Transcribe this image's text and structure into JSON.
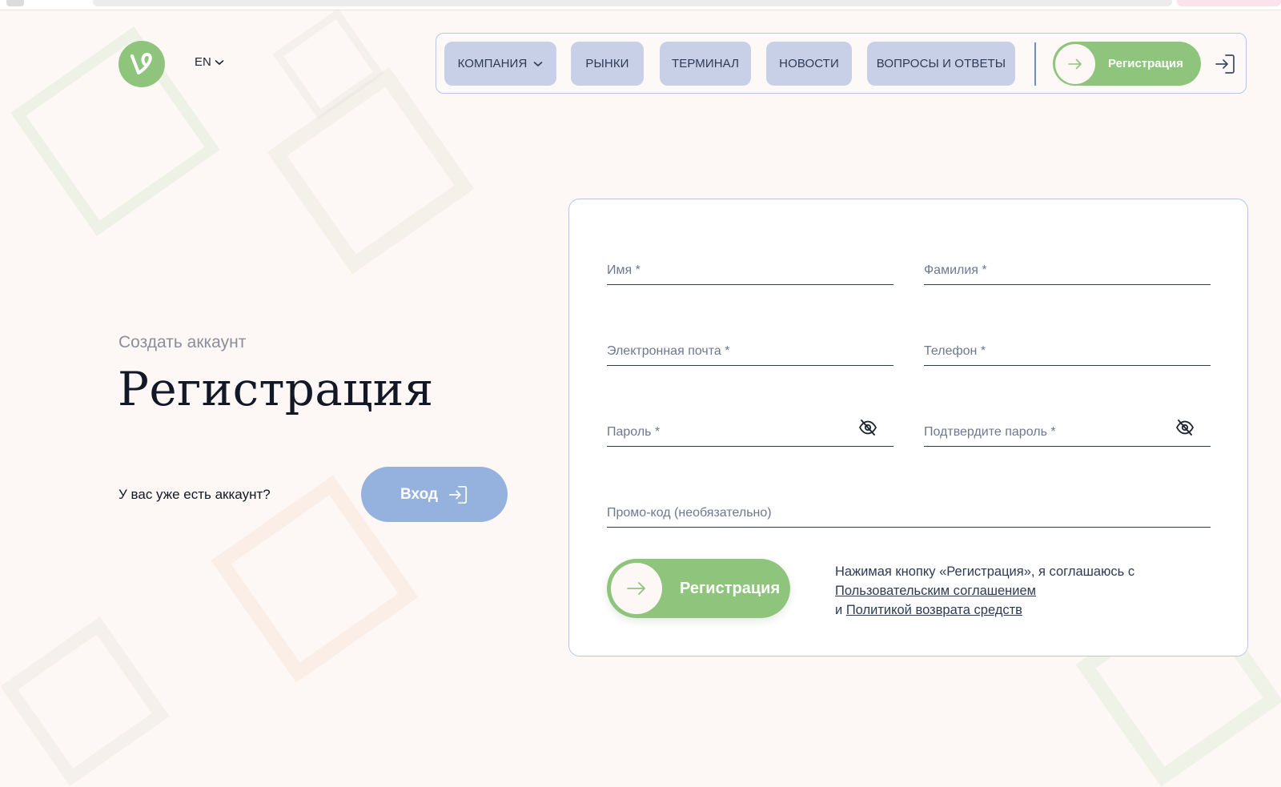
{
  "header": {
    "lang_label": "EN",
    "nav": {
      "items": [
        {
          "label": "КОМПАНИЯ"
        },
        {
          "label": "РЫНКИ"
        },
        {
          "label": "ТЕРМИНАЛ"
        },
        {
          "label": "НОВОСТИ"
        },
        {
          "label": "ВОПРОСЫ И ОТВЕТЫ"
        }
      ],
      "register_label": "Регистрация"
    }
  },
  "hero": {
    "subtitle": "Создать аккаунт",
    "title": "Регистрация",
    "have_account": "У вас уже есть аккаунт?",
    "login_label": "Вход"
  },
  "form": {
    "first_name_placeholder": "Имя *",
    "last_name_placeholder": "Фамилия *",
    "email_placeholder": "Электронная почта *",
    "phone_placeholder": "Телефон *",
    "password_placeholder": "Пароль *",
    "confirm_password_placeholder": "Подтвердите пароль *",
    "promo_placeholder": "Промо-код (необязательно)",
    "submit_label": "Регистрация",
    "terms": {
      "prefix": "Нажимая кнопку «Регистрация», я соглашаюсь с",
      "agreement_link": "Пользовательским соглашением",
      "conjunction": "и",
      "refund_link": "Политикой возврата средств"
    }
  },
  "colors": {
    "background": "#fdf8f5",
    "accent_green": "#8ec47c",
    "nav_button": "#c7d0e7",
    "login_blue": "#95b2de",
    "border_blue": "#b7c6e6"
  },
  "icons": {
    "logo": "vine-logo-icon",
    "lang_chevron": "chevron-down-icon",
    "arrow": "arrow-right-icon",
    "login": "sign-in-icon",
    "eye": "eye-off-icon"
  }
}
